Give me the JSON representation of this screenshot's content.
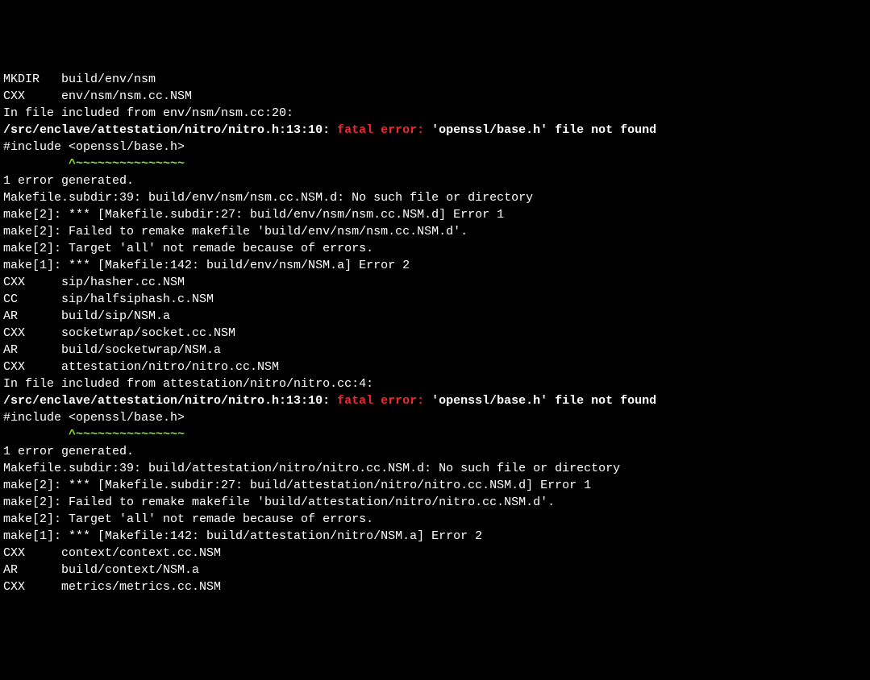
{
  "lines": [
    {
      "segs": [
        {
          "t": "MKDIR   build/env/nsm",
          "cls": "white"
        }
      ]
    },
    {
      "segs": [
        {
          "t": "CXX     env/nsm/nsm.cc.NSM",
          "cls": "white"
        }
      ]
    },
    {
      "segs": [
        {
          "t": "In file included from env/nsm/nsm.cc:20:",
          "cls": "white"
        }
      ]
    },
    {
      "segs": [
        {
          "t": "/src/enclave/attestation/nitro/nitro.h:13:10: ",
          "cls": "white bold"
        },
        {
          "t": "fatal error: ",
          "cls": "red bold"
        },
        {
          "t": "'openssl/base.h' file not found",
          "cls": "white bold"
        }
      ]
    },
    {
      "segs": [
        {
          "t": "#include <openssl/base.h>",
          "cls": "white"
        }
      ]
    },
    {
      "segs": [
        {
          "t": "         ^~~~~~~~~~~~~~~~",
          "cls": "green bold"
        }
      ]
    },
    {
      "segs": [
        {
          "t": "1 error generated.",
          "cls": "white"
        }
      ]
    },
    {
      "segs": [
        {
          "t": "Makefile.subdir:39: build/env/nsm/nsm.cc.NSM.d: No such file or directory",
          "cls": "white"
        }
      ]
    },
    {
      "segs": [
        {
          "t": "make[2]: *** [Makefile.subdir:27: build/env/nsm/nsm.cc.NSM.d] Error 1",
          "cls": "white"
        }
      ]
    },
    {
      "segs": [
        {
          "t": "make[2]: Failed to remake makefile 'build/env/nsm/nsm.cc.NSM.d'.",
          "cls": "white"
        }
      ]
    },
    {
      "segs": [
        {
          "t": "make[2]: Target 'all' not remade because of errors.",
          "cls": "white"
        }
      ]
    },
    {
      "segs": [
        {
          "t": "make[1]: *** [Makefile:142: build/env/nsm/NSM.a] Error 2",
          "cls": "white"
        }
      ]
    },
    {
      "segs": [
        {
          "t": "CXX     sip/hasher.cc.NSM",
          "cls": "white"
        }
      ]
    },
    {
      "segs": [
        {
          "t": "CC      sip/halfsiphash.c.NSM",
          "cls": "white"
        }
      ]
    },
    {
      "segs": [
        {
          "t": "AR      build/sip/NSM.a",
          "cls": "white"
        }
      ]
    },
    {
      "segs": [
        {
          "t": "CXX     socketwrap/socket.cc.NSM",
          "cls": "white"
        }
      ]
    },
    {
      "segs": [
        {
          "t": "AR      build/socketwrap/NSM.a",
          "cls": "white"
        }
      ]
    },
    {
      "segs": [
        {
          "t": "CXX     attestation/nitro/nitro.cc.NSM",
          "cls": "white"
        }
      ]
    },
    {
      "segs": [
        {
          "t": "In file included from attestation/nitro/nitro.cc:4:",
          "cls": "white"
        }
      ]
    },
    {
      "segs": [
        {
          "t": "/src/enclave/attestation/nitro/nitro.h:13:10: ",
          "cls": "white bold"
        },
        {
          "t": "fatal error: ",
          "cls": "red bold"
        },
        {
          "t": "'openssl/base.h' file not found",
          "cls": "white bold"
        }
      ]
    },
    {
      "segs": [
        {
          "t": "#include <openssl/base.h>",
          "cls": "white"
        }
      ]
    },
    {
      "segs": [
        {
          "t": "         ^~~~~~~~~~~~~~~~",
          "cls": "green bold"
        }
      ]
    },
    {
      "segs": [
        {
          "t": "1 error generated.",
          "cls": "white"
        }
      ]
    },
    {
      "segs": [
        {
          "t": "Makefile.subdir:39: build/attestation/nitro/nitro.cc.NSM.d: No such file or directory",
          "cls": "white"
        }
      ]
    },
    {
      "segs": [
        {
          "t": "make[2]: *** [Makefile.subdir:27: build/attestation/nitro/nitro.cc.NSM.d] Error 1",
          "cls": "white"
        }
      ]
    },
    {
      "segs": [
        {
          "t": "make[2]: Failed to remake makefile 'build/attestation/nitro/nitro.cc.NSM.d'.",
          "cls": "white"
        }
      ]
    },
    {
      "segs": [
        {
          "t": "make[2]: Target 'all' not remade because of errors.",
          "cls": "white"
        }
      ]
    },
    {
      "segs": [
        {
          "t": "make[1]: *** [Makefile:142: build/attestation/nitro/NSM.a] Error 2",
          "cls": "white"
        }
      ]
    },
    {
      "segs": [
        {
          "t": "CXX     context/context.cc.NSM",
          "cls": "white"
        }
      ]
    },
    {
      "segs": [
        {
          "t": "AR      build/context/NSM.a",
          "cls": "white"
        }
      ]
    },
    {
      "segs": [
        {
          "t": "CXX     metrics/metrics.cc.NSM",
          "cls": "white"
        }
      ]
    }
  ]
}
